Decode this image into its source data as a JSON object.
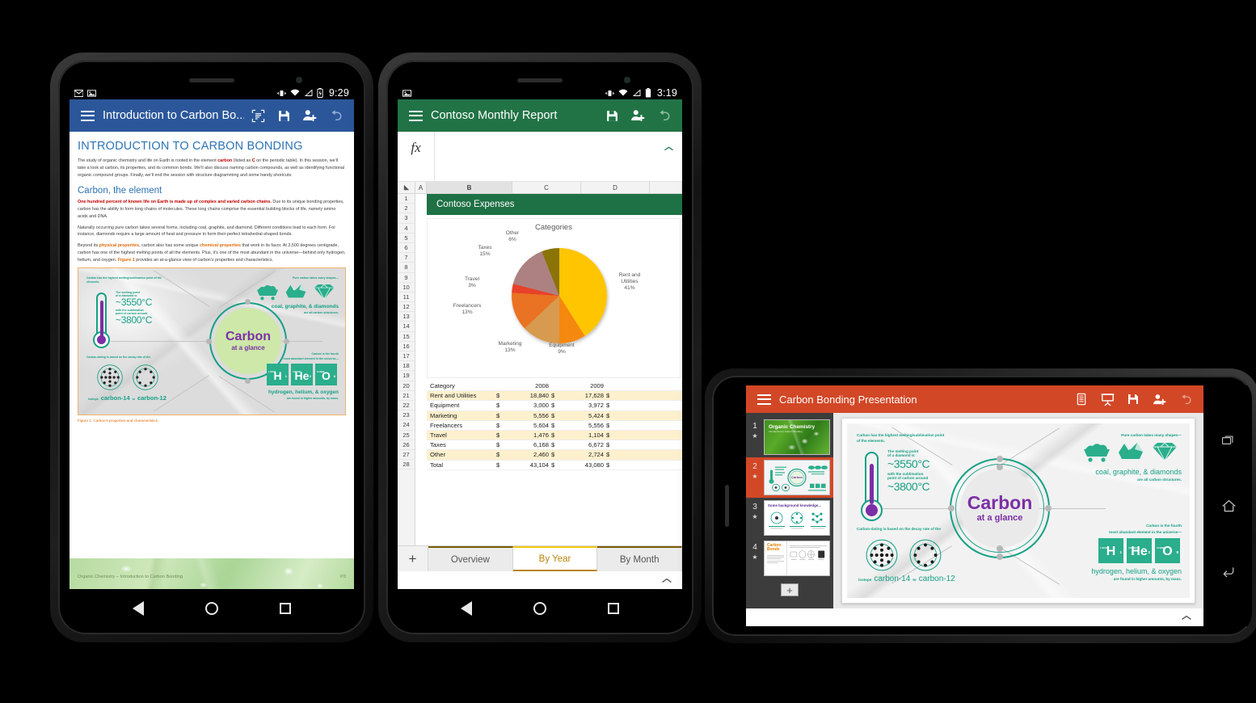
{
  "scene": {
    "background": "#000000",
    "devices": [
      "word-phone",
      "excel-phone",
      "powerpoint-tablet"
    ]
  },
  "word_phone": {
    "status_bar": {
      "time": "9:29",
      "left_icons": [
        "gmail-icon",
        "screenshot-icon"
      ],
      "right_icons": [
        "vibrate-icon",
        "wifi-icon",
        "signal-icon",
        "battery-charging-icon"
      ]
    },
    "app_bar": {
      "accent": "#2b579a",
      "menu": "menu-icon",
      "title": "Introduction to Carbon Bo...",
      "actions": [
        "reflow-icon",
        "save-icon",
        "share-icon",
        "undo-icon"
      ]
    },
    "document": {
      "heading": "INTRODUCTION TO CARBON BONDING",
      "intro": {
        "before": "The study of organic chemistry and life on Earth is rooted in the element ",
        "em1": "carbon",
        "mid": " (listed as ",
        "em2": "C",
        "after": " on the periodic table). In this session, we’ll take a look at carbon, its properties, and its common bonds. We’ll also discuss naming carbon compounds, as well as identifying functional organic compound groups. Finally, we’ll end the session with structure diagramming and some handy shortcuts."
      },
      "subheading": "Carbon, the element",
      "para1_lead": "One hundred percent of known life on Earth is made up of complex and varied carbon chains.",
      "para1_rest": " Due to its unique bonding properties, carbon has the ability to form long chains of molecules. These long chains comprise the essential building blocks of life, namely amino acids and DNA.",
      "para2": "Naturally occurring pure carbon takes several forms, including coal, graphite, and diamond. Different conditions lead to each form. For instance, diamonds require a large amount of heat and pressure to form their perfect tetrahedral-shaped bonds.",
      "para3": {
        "a": "Beyond its ",
        "em1": "physical properties",
        "b": ", carbon also has some unique ",
        "em2": "chemical properties",
        "c": " that work in its favor. At 3,500 degrees centigrade, carbon has one of the highest melting points of all the elements. Plus, it’s one of the most abundant in the universe—behind only hydrogen, helium, and oxygen. ",
        "em3": "Figure 1",
        "d": " provides an at-a-glance view of carbon’s properties and characteristics."
      },
      "figure_caption": "Figure 1: Carbon’s properties and characteristics",
      "footer_text": "Organic Chemistry – Introduction to Carbon Bonding",
      "footer_page": "P3"
    },
    "nav_bar": [
      "back-icon",
      "home-icon",
      "recents-icon"
    ]
  },
  "infographic": {
    "hub_line1": "Carbon",
    "hub_line2": "at a glance",
    "thermo_caption": "Carbon has the highest melting/sublimation point of the elements.",
    "thermo_l1": "The melting point",
    "thermo_l2": "of a diamond is",
    "thermo_big1": "~3550°C",
    "thermo_l3": "with the sublimation",
    "thermo_l4": "point of carbon around",
    "thermo_big2": "~3800°C",
    "shapes_caption": "Pure carbon takes many shapes—",
    "shapes_bold": "coal, graphite, & diamonds",
    "shapes_sub": "are all carbon structures.",
    "decay_caption": "Carbon-dating is based on the decay rate of the",
    "isotope_prefix": "isotope",
    "isotope_a": "carbon-14",
    "isotope_mid": "to",
    "isotope_b": "carbon-12",
    "elements_caption1": "Carbon is the fourth",
    "elements_caption2": "most abundant element in the universe—",
    "elements_bold": "hydrogen, helium, & oxygen",
    "elements_sub": "are found in higher amounts, by mass.",
    "elements": [
      {
        "symbol": "H",
        "number": "1",
        "mass": "1.00794"
      },
      {
        "symbol": "He",
        "number": "2",
        "mass": "4.002602"
      },
      {
        "symbol": "O",
        "number": "8",
        "mass": "15.9994"
      }
    ],
    "colors": {
      "teal": "#16a085",
      "purple": "#7b2fa5",
      "green_fill": "#cde8a8",
      "orange_border": "#f0b26b"
    }
  },
  "excel_phone": {
    "status_bar": {
      "time": "3:19",
      "left_icons": [
        "screenshot-icon"
      ],
      "right_icons": [
        "vibrate-icon",
        "wifi-icon",
        "signal-icon",
        "battery-icon"
      ]
    },
    "app_bar": {
      "accent": "#217346",
      "menu": "menu-icon",
      "title": "Contoso Monthly Report",
      "actions": [
        "save-icon",
        "share-icon",
        "undo-icon"
      ]
    },
    "formula_bar": {
      "label": "fx",
      "value": "",
      "expand": "chevron-up-icon"
    },
    "columns": [
      "A",
      "B",
      "C",
      "D"
    ],
    "selected_column": "B",
    "rows": [
      "1",
      "2",
      "3",
      "4",
      "5",
      "6",
      "7",
      "8",
      "9",
      "10",
      "11",
      "12",
      "13",
      "14",
      "15",
      "16",
      "17",
      "18",
      "19",
      "20",
      "21",
      "22",
      "23",
      "24",
      "25",
      "26",
      "27",
      "28"
    ],
    "banner_cell": "Contoso Expenses",
    "chart_data": {
      "type": "pie",
      "title": "Categories",
      "categories": [
        "Rent and Utilities",
        "Equipment",
        "Marketing",
        "Freelancers",
        "Travel",
        "Taxes",
        "Other"
      ],
      "values": [
        41,
        9,
        13,
        13,
        3,
        15,
        6
      ],
      "value_unit": "%",
      "labels": [
        {
          "name": "Rent and Utilities",
          "pct": "41%"
        },
        {
          "name": "Equipment",
          "pct": "9%"
        },
        {
          "name": "Marketing",
          "pct": "13%"
        },
        {
          "name": "Freelancers",
          "pct": "13%"
        },
        {
          "name": "Travel",
          "pct": "3%"
        },
        {
          "name": "Taxes",
          "pct": "15%"
        },
        {
          "name": "Other",
          "pct": "6%"
        }
      ],
      "colors": [
        "#ffc500",
        "#f5880f",
        "#d79a4e",
        "#ea7223",
        "#e8412a",
        "#ad8181",
        "#8a7407"
      ],
      "legend": "data labels",
      "grid": false
    },
    "table": {
      "headers": [
        "Category",
        "2008",
        "2009"
      ],
      "header_row": "19",
      "rows": [
        {
          "row": "20",
          "category": "Rent and Utilities",
          "y2008": "18,840",
          "y2009": "17,628"
        },
        {
          "row": "21",
          "category": "Equipment",
          "y2008": "3,000",
          "y2009": "3,972"
        },
        {
          "row": "22",
          "category": "Marketing",
          "y2008": "5,556",
          "y2009": "5,424"
        },
        {
          "row": "23",
          "category": "Freelancers",
          "y2008": "5,604",
          "y2009": "5,556"
        },
        {
          "row": "24",
          "category": "Travel",
          "y2008": "1,476",
          "y2009": "1,104"
        },
        {
          "row": "25",
          "category": "Taxes",
          "y2008": "6,168",
          "y2009": "6,672"
        },
        {
          "row": "26",
          "category": "Other",
          "y2008": "2,460",
          "y2009": "2,724"
        },
        {
          "row": "27",
          "category": "Total",
          "y2008": "43,104",
          "y2009": "43,080"
        }
      ],
      "currency": "$"
    },
    "sheet_tabs": {
      "add_label": "+",
      "tabs": [
        {
          "label": "Overview",
          "active": false
        },
        {
          "label": "By Year",
          "active": true
        },
        {
          "label": "By Month",
          "active": false
        }
      ]
    },
    "expand": "chevron-up-icon",
    "nav_bar": [
      "back-icon",
      "home-icon",
      "recents-icon"
    ]
  },
  "powerpoint_tablet": {
    "app_bar": {
      "accent": "#d24726",
      "menu": "menu-icon",
      "title": "Carbon Bonding Presentation",
      "actions": [
        "notes-icon",
        "present-icon",
        "save-icon",
        "share-icon",
        "undo-icon"
      ]
    },
    "slides": [
      {
        "number": "1",
        "title": "Organic Chemistry",
        "subtitle": "Introduction to Carbon Bonding",
        "selected": false,
        "kind": "title-green"
      },
      {
        "number": "2",
        "title": "",
        "selected": true,
        "kind": "infographic"
      },
      {
        "number": "3",
        "title": "Some background knowledge...",
        "selected": false,
        "kind": "diagram-3"
      },
      {
        "number": "4",
        "title": "Carbon Bonds",
        "selected": false,
        "kind": "diagram-4"
      }
    ],
    "add_slide": "+",
    "expand": "chevron-up-icon",
    "nav_bar": [
      "recents-icon",
      "home-icon",
      "back-icon"
    ]
  }
}
